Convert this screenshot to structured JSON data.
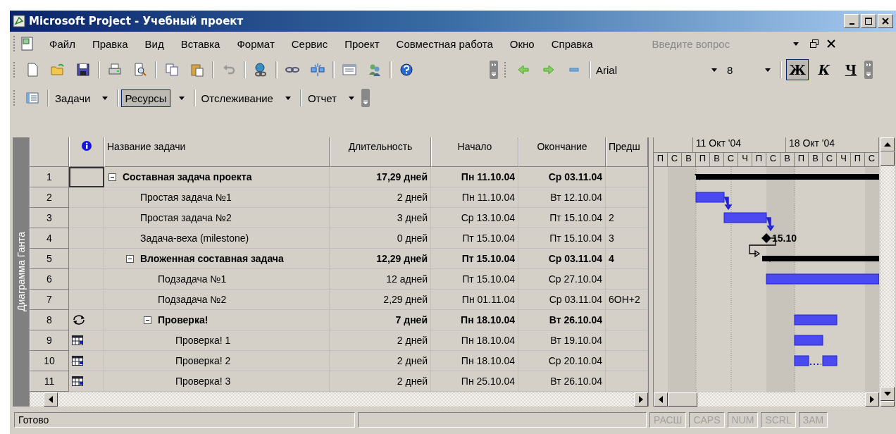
{
  "window": {
    "title": "Microsoft Project - Учебный проект"
  },
  "menu": {
    "items": [
      {
        "label": "Файл"
      },
      {
        "label": "Правка"
      },
      {
        "label": "Вид"
      },
      {
        "label": "Вставка"
      },
      {
        "label": "Формат"
      },
      {
        "label": "Сервис"
      },
      {
        "label": "Проект"
      },
      {
        "label": "Совместная работа"
      },
      {
        "label": "Окно"
      },
      {
        "label": "Справка"
      }
    ],
    "help_box": {
      "placeholder": "Введите вопрос"
    }
  },
  "formatting": {
    "font": "Arial",
    "size": "8",
    "styles": [
      {
        "label": "Ж",
        "selected": true
      },
      {
        "label": "К",
        "selected": false
      },
      {
        "label": "Ч",
        "selected": false
      }
    ]
  },
  "view_bar": {
    "items": [
      {
        "label": "Задачи",
        "selected": false
      },
      {
        "label": "Ресурсы",
        "selected": true
      },
      {
        "label": "Отслеживание",
        "selected": false
      },
      {
        "label": "Отчет",
        "selected": false
      }
    ]
  },
  "view_label": "Диаграмма Ганта",
  "table": {
    "columns": [
      "Название задачи",
      "Длительность",
      "Начало",
      "Окончание",
      "Предш"
    ],
    "rows": [
      {
        "id": "1",
        "selected": true,
        "name": "Составная задача проекта",
        "duration": "17,29 дней",
        "start": "Пн 11.10.04",
        "finish": "Ср 03.11.04",
        "expanded": true,
        "children": [
          {
            "id": "2",
            "selected": false,
            "name": "Простая задача №1",
            "duration": "2 дней",
            "start": "Пн 11.10.04",
            "finish": "Вт 12.10.04"
          },
          {
            "id": "3",
            "selected": false,
            "name": "Простая задача №2",
            "duration": "3 дней",
            "start": "Ср 13.10.04",
            "finish": "Пт 15.10.04",
            "predecessors": "2"
          },
          {
            "id": "4",
            "selected": false,
            "name": "Задача-веха (milestone)",
            "duration": "0 дней",
            "start": "Пт 15.10.04",
            "finish": "Пт 15.10.04",
            "predecessors": "3"
          },
          {
            "id": "5",
            "selected": false,
            "name": "Вложенная составная задача",
            "duration": "12,29 дней",
            "start": "Пт 15.10.04",
            "finish": "Ср 03.11.04",
            "predecessors": "4",
            "expanded": true,
            "children": [
              {
                "id": "6",
                "selected": false,
                "name": "Подзадача №1",
                "duration": "12 адней",
                "start": "Пт 15.10.04",
                "finish": "Ср 27.10.04"
              },
              {
                "id": "7",
                "selected": false,
                "name": "Подзадача №2",
                "duration": "2,29 дней",
                "start": "Пн 01.11.04",
                "finish": "Ср 03.11.04",
                "predecessors": "6ОН+2"
              },
              {
                "id": "8",
                "kind": "recurring",
                "selected": false,
                "name": "Проверка!",
                "duration": "7 дней",
                "start": "Пн 18.10.04",
                "finish": "Вт 26.10.04",
                "expanded": true,
                "children": [
                  {
                    "id": "9",
                    "kind": "calendar",
                    "selected": false,
                    "name": "Проверка! 1",
                    "duration": "2 дней",
                    "start": "Пн 18.10.04",
                    "finish": "Вт 19.10.04"
                  },
                  {
                    "id": "10",
                    "kind": "calendar",
                    "selected": false,
                    "name": "Проверка! 2",
                    "duration": "2 дней",
                    "start": "Пн 18.10.04",
                    "finish": "Ср 20.10.04"
                  },
                  {
                    "id": "11",
                    "kind": "calendar",
                    "selected": false,
                    "name": "Проверка! 3",
                    "duration": "2 дней",
                    "start": "Пн 25.10.04",
                    "finish": "Вт 26.10.04"
                  }
                ]
              }
            ]
          }
        ]
      }
    ]
  },
  "gantt": {
    "weeks": [
      "11 Окт '04",
      "18 Окт '04"
    ],
    "days": [
      "П",
      "С",
      "В",
      "П",
      "В",
      "С",
      "Ч",
      "П",
      "С",
      "В",
      "П",
      "В",
      "С",
      "Ч",
      "П",
      "С"
    ],
    "milestone_label": "15.10"
  },
  "status_bar": {
    "text": "Готово",
    "indicators": [
      {
        "label": "РАСШ",
        "on": false
      },
      {
        "label": "CAPS",
        "on": false
      },
      {
        "label": "NUM",
        "on": false
      },
      {
        "label": "SCRL",
        "on": false
      },
      {
        "label": "ЗАМ",
        "on": false
      }
    ]
  }
}
